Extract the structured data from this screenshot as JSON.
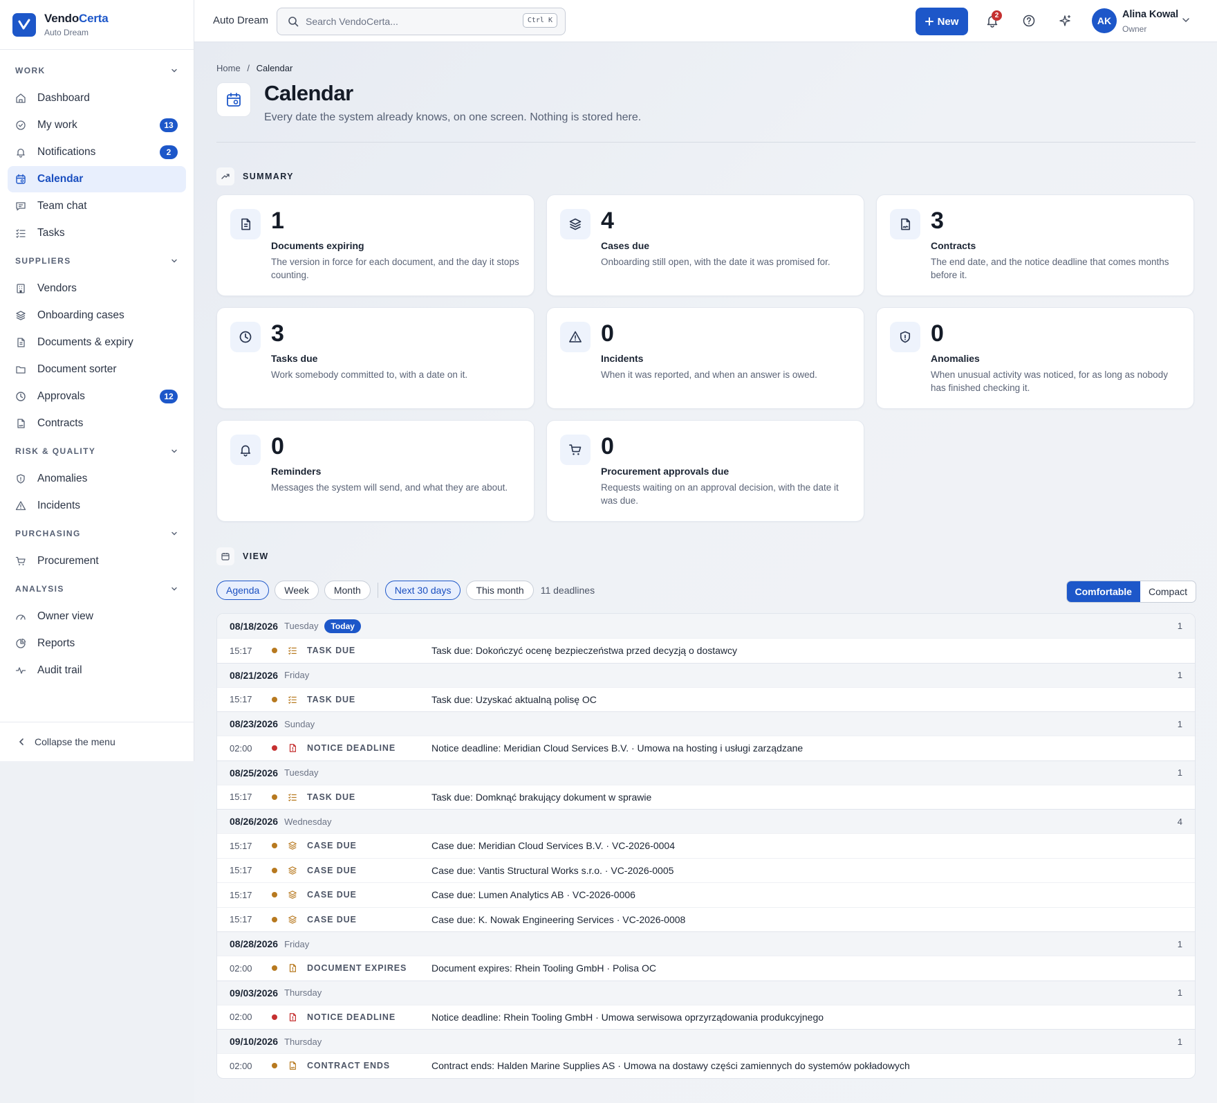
{
  "brand": {
    "name_a": "Vendo",
    "name_b": "Certa",
    "workspace": "Auto Dream"
  },
  "sidebar": {
    "sections": [
      {
        "label": "WORK",
        "items": [
          {
            "label": "Dashboard",
            "icon": "home-icon"
          },
          {
            "label": "My work",
            "icon": "check-circle-icon",
            "badge": "13"
          },
          {
            "label": "Notifications",
            "icon": "bell-icon",
            "badge": "2"
          },
          {
            "label": "Calendar",
            "icon": "calendar-icon",
            "active": true
          },
          {
            "label": "Team chat",
            "icon": "chat-icon"
          },
          {
            "label": "Tasks",
            "icon": "list-check-icon"
          }
        ]
      },
      {
        "label": "SUPPLIERS",
        "items": [
          {
            "label": "Vendors",
            "icon": "building-icon"
          },
          {
            "label": "Onboarding cases",
            "icon": "layers-icon"
          },
          {
            "label": "Documents & expiry",
            "icon": "document-icon"
          },
          {
            "label": "Document sorter",
            "icon": "folder-icon"
          },
          {
            "label": "Approvals",
            "icon": "clock-icon",
            "badge": "12"
          },
          {
            "label": "Contracts",
            "icon": "contract-icon"
          }
        ]
      },
      {
        "label": "RISK & QUALITY",
        "items": [
          {
            "label": "Anomalies",
            "icon": "shield-icon"
          },
          {
            "label": "Incidents",
            "icon": "warning-icon"
          }
        ]
      },
      {
        "label": "PURCHASING",
        "items": [
          {
            "label": "Procurement",
            "icon": "cart-icon"
          }
        ]
      },
      {
        "label": "ANALYSIS",
        "items": [
          {
            "label": "Owner view",
            "icon": "gauge-icon"
          },
          {
            "label": "Reports",
            "icon": "pie-icon"
          },
          {
            "label": "Audit trail",
            "icon": "activity-icon"
          }
        ]
      }
    ],
    "collapse": "Collapse the menu"
  },
  "topbar": {
    "workspace": "Auto Dream",
    "search_placeholder": "Search VendoCerta...",
    "search_kbd": "Ctrl K",
    "new_label": "New",
    "notif_count": "2",
    "user": {
      "initials": "AK",
      "name": "Alina Kowal",
      "role": "Owner"
    }
  },
  "page": {
    "breadcrumb": [
      "Home",
      "Calendar"
    ],
    "title": "Calendar",
    "subtitle": "Every date the system already knows, on one screen. Nothing is stored here."
  },
  "summary": {
    "heading": "SUMMARY",
    "cards": [
      {
        "n": "1",
        "label": "Documents expiring",
        "desc": "The version in force for each document, and the day it stops counting.",
        "icon": "document-icon"
      },
      {
        "n": "4",
        "label": "Cases due",
        "desc": "Onboarding still open, with the date it was promised for.",
        "icon": "layers-icon"
      },
      {
        "n": "3",
        "label": "Contracts",
        "desc": "The end date, and the notice deadline that comes months before it.",
        "icon": "contract-icon"
      },
      {
        "n": "3",
        "label": "Tasks due",
        "desc": "Work somebody committed to, with a date on it.",
        "icon": "clock-icon"
      },
      {
        "n": "0",
        "label": "Incidents",
        "desc": "When it was reported, and when an answer is owed.",
        "icon": "warning-icon"
      },
      {
        "n": "0",
        "label": "Anomalies",
        "desc": "When unusual activity was noticed, for as long as nobody has finished checking it.",
        "icon": "shield-icon"
      },
      {
        "n": "0",
        "label": "Reminders",
        "desc": "Messages the system will send, and what they are about.",
        "icon": "bell-icon"
      },
      {
        "n": "0",
        "label": "Procurement approvals due",
        "desc": "Requests waiting on an approval decision, with the date it was due.",
        "icon": "cart-icon"
      }
    ]
  },
  "view": {
    "heading": "VIEW",
    "modes": [
      "Agenda",
      "Week",
      "Month"
    ],
    "ranges": [
      "Next 30 days",
      "This month"
    ],
    "count": "11 deadlines",
    "density": [
      "Comfortable",
      "Compact"
    ]
  },
  "colors": {
    "accent": "#1d57c9",
    "dot_task": "#b7791f",
    "dot_red": "#c53030"
  },
  "agenda": [
    {
      "date": "08/18/2026",
      "weekday": "Tuesday",
      "today": "Today",
      "count": "1",
      "events": [
        {
          "time": "15:17",
          "kind": "TASK DUE",
          "icon": "list-check-icon",
          "dot": "amber",
          "title": "Task due: Dokończyć ocenę bezpieczeństwa przed decyzją o dostawcy"
        }
      ]
    },
    {
      "date": "08/21/2026",
      "weekday": "Friday",
      "count": "1",
      "events": [
        {
          "time": "15:17",
          "kind": "TASK DUE",
          "icon": "list-check-icon",
          "dot": "amber",
          "title": "Task due: Uzyskać aktualną polisę OC"
        }
      ]
    },
    {
      "date": "08/23/2026",
      "weekday": "Sunday",
      "count": "1",
      "events": [
        {
          "time": "02:00",
          "kind": "NOTICE DEADLINE",
          "icon": "document-alert-icon",
          "dot": "red",
          "title": "Notice deadline: Meridian Cloud Services B.V. · Umowa na hosting i usługi zarządzane"
        }
      ]
    },
    {
      "date": "08/25/2026",
      "weekday": "Tuesday",
      "count": "1",
      "events": [
        {
          "time": "15:17",
          "kind": "TASK DUE",
          "icon": "list-check-icon",
          "dot": "amber",
          "title": "Task due: Domknąć brakujący dokument w sprawie"
        }
      ]
    },
    {
      "date": "08/26/2026",
      "weekday": "Wednesday",
      "count": "4",
      "events": [
        {
          "time": "15:17",
          "kind": "CASE DUE",
          "icon": "layers-icon",
          "dot": "amber",
          "title": "Case due: Meridian Cloud Services B.V. · VC-2026-0004"
        },
        {
          "time": "15:17",
          "kind": "CASE DUE",
          "icon": "layers-icon",
          "dot": "amber",
          "title": "Case due: Vantis Structural Works s.r.o. · VC-2026-0005"
        },
        {
          "time": "15:17",
          "kind": "CASE DUE",
          "icon": "layers-icon",
          "dot": "amber",
          "title": "Case due: Lumen Analytics AB · VC-2026-0006"
        },
        {
          "time": "15:17",
          "kind": "CASE DUE",
          "icon": "layers-icon",
          "dot": "amber",
          "title": "Case due: K. Nowak Engineering Services · VC-2026-0008"
        }
      ]
    },
    {
      "date": "08/28/2026",
      "weekday": "Friday",
      "count": "1",
      "events": [
        {
          "time": "02:00",
          "kind": "DOCUMENT EXPIRES",
          "icon": "document-alert-icon",
          "dot": "amber",
          "title": "Document expires: Rhein Tooling GmbH · Polisa OC"
        }
      ]
    },
    {
      "date": "09/03/2026",
      "weekday": "Thursday",
      "count": "1",
      "events": [
        {
          "time": "02:00",
          "kind": "NOTICE DEADLINE",
          "icon": "document-alert-icon",
          "dot": "red",
          "title": "Notice deadline: Rhein Tooling GmbH · Umowa serwisowa oprzyrządowania produkcyjnego"
        }
      ]
    },
    {
      "date": "09/10/2026",
      "weekday": "Thursday",
      "count": "1",
      "events": [
        {
          "time": "02:00",
          "kind": "CONTRACT ENDS",
          "icon": "contract-icon",
          "dot": "amber",
          "title": "Contract ends: Halden Marine Supplies AS · Umowa na dostawy części zamiennych do systemów pokładowych"
        }
      ]
    }
  ]
}
